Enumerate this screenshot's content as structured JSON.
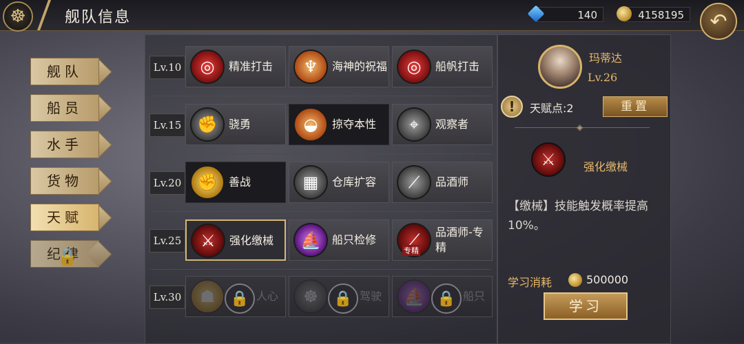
{
  "header": {
    "title": "舰队信息",
    "gems": "140",
    "gold": "4158195",
    "menu_icon": "ship-wheel-icon",
    "back_icon": "back-arrow-icon"
  },
  "sidebar": {
    "items": [
      {
        "label": "舰队"
      },
      {
        "label": "船员"
      },
      {
        "label": "水手"
      },
      {
        "label": "货物"
      },
      {
        "label": "天赋",
        "active": true
      },
      {
        "label": "纪律",
        "locked": true
      }
    ]
  },
  "talents": {
    "rows": [
      {
        "level": "Lv.10",
        "skills": [
          {
            "name": "精准打击",
            "icon": "crosshair-target-icon",
            "color": "#c0282a"
          },
          {
            "name": "海神的祝福",
            "icon": "poseidon-blessing-icon",
            "color": "#d06a2a"
          },
          {
            "name": "船帆打击",
            "icon": "sail-target-icon",
            "color": "#c0282a"
          }
        ]
      },
      {
        "level": "Lv.15",
        "skills": [
          {
            "name": "骁勇",
            "icon": "raised-fist-icon",
            "color": "#777777"
          },
          {
            "name": "掠夺本性",
            "icon": "plunder-bowl-icon",
            "color": "#e0702a",
            "dark": true
          },
          {
            "name": "观察者",
            "icon": "telescope-icon",
            "color": "#777777"
          }
        ]
      },
      {
        "level": "Lv.20",
        "skills": [
          {
            "name": "善战",
            "icon": "golden-fist-icon",
            "color": "#d9a71c",
            "dark": true
          },
          {
            "name": "仓库扩容",
            "icon": "storage-crates-icon",
            "color": "#888888"
          },
          {
            "name": "品酒师",
            "icon": "wine-bottle-icon",
            "color": "#666666"
          }
        ]
      },
      {
        "level": "Lv.25",
        "skills": [
          {
            "name": "强化缴械",
            "icon": "disarm-blade-icon",
            "color": "#b02a26",
            "selected": true
          },
          {
            "name": "船只检修",
            "icon": "ship-repair-icon",
            "color": "#8a2ab8"
          },
          {
            "name": "品酒师-专精",
            "icon": "wine-bottle-icon",
            "color": "#c04a18",
            "tag": "专精"
          }
        ]
      },
      {
        "level": "Lv.30",
        "skills": [
          {
            "name": "人心",
            "icon": "figure-icon",
            "color": "#a07a30",
            "locked": true
          },
          {
            "name": "驾驶",
            "icon": "ship-wheel-icon",
            "color": "#3a6a9a",
            "locked": true
          },
          {
            "name": "船只",
            "icon": "ship-icon",
            "color": "#7a3aa8",
            "locked": true
          }
        ]
      }
    ]
  },
  "detail": {
    "captain_name": "玛蒂达",
    "captain_level": "Lv.26",
    "talent_points": "天赋点:2",
    "reset_label": "重置",
    "selected_skill_name": "强化缴械",
    "selected_skill_icon": "disarm-blade-icon",
    "description": "【缴械】技能触发概率提高10%。",
    "cost_label": "学习消耗",
    "cost_value": "500000",
    "learn_label": "学习"
  }
}
